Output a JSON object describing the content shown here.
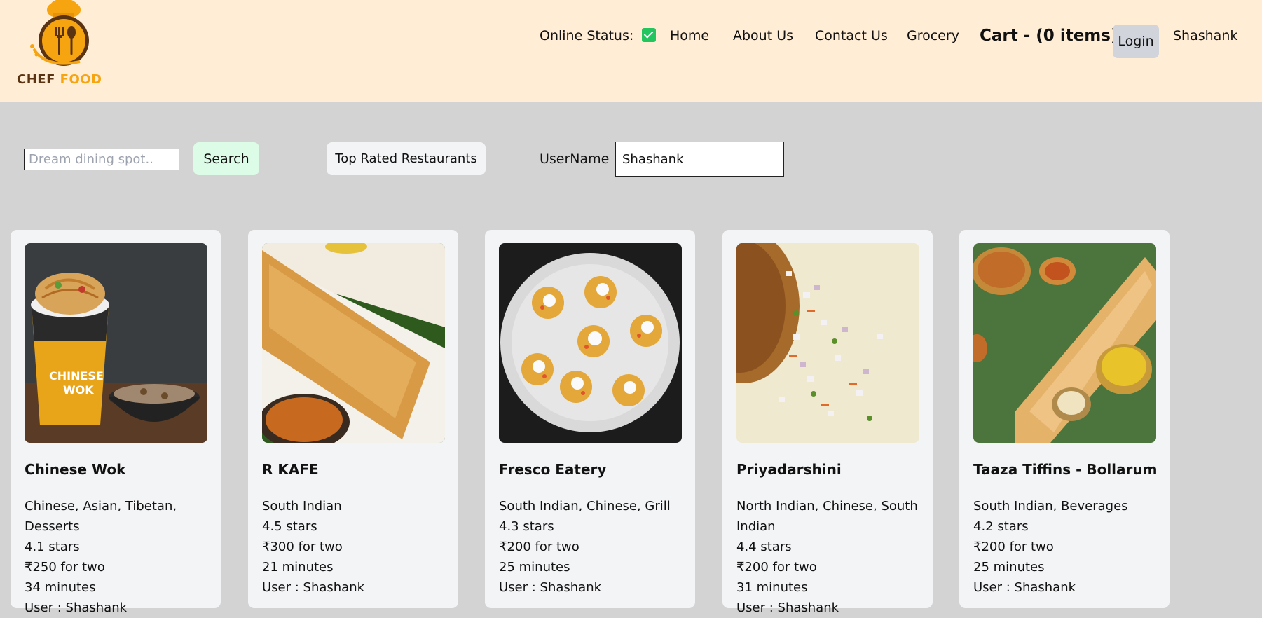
{
  "header": {
    "logo": {
      "text_primary": "CHEF",
      "text_accent": "FOOD"
    },
    "online_status_label": "Online Status:",
    "online_status_value": "✓",
    "nav": {
      "home": "Home",
      "about": "About Us",
      "contact": "Contact Us",
      "grocery": "Grocery",
      "cart": "Cart - (0 items)",
      "login": "Login",
      "user": "Shashank"
    }
  },
  "controls": {
    "search_placeholder": "Dream dining spot..",
    "search_value": "",
    "search_button": "Search",
    "top_rated_button": "Top Rated Restaurants",
    "username_label": "UserName :",
    "username_value": "Shashank"
  },
  "restaurants": [
    {
      "name": "Chinese Wok",
      "cuisines": "Chinese, Asian, Tibetan, Desserts",
      "rating": "4.1 stars",
      "cost": "₹250 for two",
      "time": "34 minutes",
      "user": "User : Shashank"
    },
    {
      "name": "R KAFE",
      "cuisines": "South Indian",
      "rating": "4.5 stars",
      "cost": "₹300 for two",
      "time": "21 minutes",
      "user": "User : Shashank"
    },
    {
      "name": "Fresco Eatery",
      "cuisines": "South Indian, Chinese, Grill",
      "rating": "4.3 stars",
      "cost": "₹200 for two",
      "time": "25 minutes",
      "user": "User : Shashank"
    },
    {
      "name": "Priyadarshini",
      "cuisines": "North Indian, Chinese, South Indian",
      "rating": "4.4 stars",
      "cost": "₹200 for two",
      "time": "31 minutes",
      "user": "User : Shashank"
    },
    {
      "name": "Taaza Tiffins - Bollarum i",
      "cuisines": "South Indian, Beverages",
      "rating": "4.2 stars",
      "cost": "₹200 for two",
      "time": "25 minutes",
      "user": "User : Shashank"
    }
  ],
  "colors": {
    "header_bg": "#ffedd5",
    "page_bg": "#d3d3d3",
    "card_bg": "#f3f4f6",
    "search_button_bg": "#dcfce7",
    "login_button_bg": "#d1d5db",
    "status_green": "#22c55e",
    "logo_orange": "#f6a410",
    "logo_brown": "#5a3312"
  }
}
